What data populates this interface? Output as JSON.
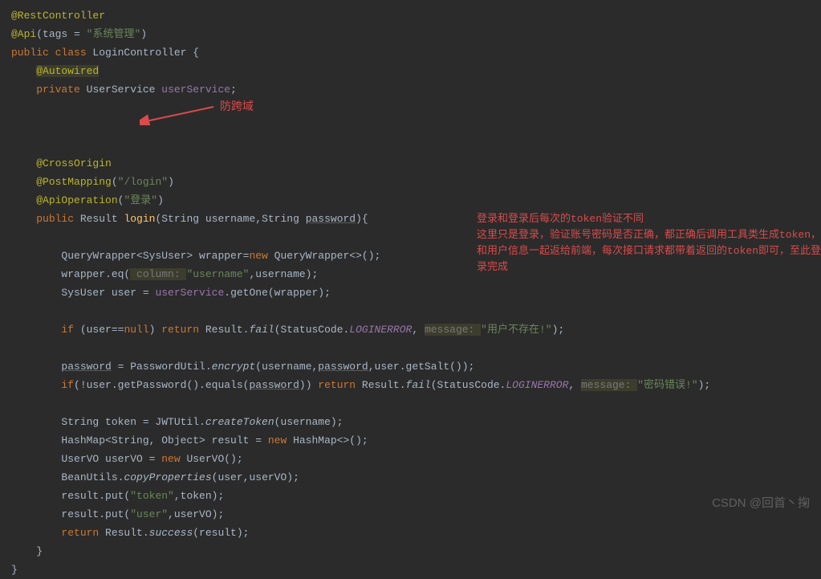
{
  "code": {
    "l1a": "@RestController",
    "l2a": "@Api",
    "l2b": "(tags = ",
    "l2c": "\"系统管理\"",
    "l2d": ")",
    "l3a": "public class ",
    "l3b": "LoginController {",
    "l4a": "    ",
    "l4b": "@Autowired",
    "l5a": "    ",
    "l5b": "private ",
    "l5c": "UserService ",
    "l5d": "userService",
    "l5e": ";",
    "l6a": "    ",
    "l6b": "@CrossOrigin",
    "l7a": "    ",
    "l7b": "@PostMapping",
    "l7c": "(",
    "l7d": "\"/login\"",
    "l7e": ")",
    "l8a": "    ",
    "l8b": "@ApiOperation",
    "l8c": "(",
    "l8d": "\"登录\"",
    "l8e": ")",
    "l9a": "    ",
    "l9b": "public ",
    "l9c": "Result ",
    "l9d": "login",
    "l9e": "(String username,String ",
    "l9f": "password",
    "l9g": "){",
    "l10a": "        QueryWrapper<SysUser> wrapper=",
    "l10b": "new ",
    "l10c": "QueryWrapper<>();",
    "l11a": "        wrapper.eq(",
    "l11b": " column: ",
    "l11c": "\"username\"",
    "l11d": ",username);",
    "l12a": "        SysUser user = ",
    "l12b": "userService",
    "l12c": ".getOne(wrapper);",
    "l13a": "        ",
    "l13b": "if ",
    "l13c": "(user==",
    "l13d": "null",
    "l13e": ") ",
    "l13f": "return ",
    "l13g": "Result.",
    "l13h": "fail",
    "l13i": "(StatusCode.",
    "l13j": "LOGINERROR",
    "l13k": ", ",
    "l13l": "message: ",
    "l13m": "\"用户不存在!\"",
    "l13n": ");",
    "l14a": "        ",
    "l14b": "password",
    "l14c": " = PasswordUtil.",
    "l14d": "encrypt",
    "l14e": "(username,",
    "l14f": "password",
    "l14g": ",user.getSalt());",
    "l15a": "        ",
    "l15b": "if",
    "l15c": "(!user.getPassword().equals(",
    "l15d": "password",
    "l15e": ")) ",
    "l15f": "return ",
    "l15g": "Result.",
    "l15h": "fail",
    "l15i": "(StatusCode.",
    "l15j": "LOGINERROR",
    "l15k": ", ",
    "l15l": "message: ",
    "l15m": "\"密码错误!\"",
    "l15n": ");",
    "l16a": "        String token = JWTUtil.",
    "l16b": "createToken",
    "l16c": "(username);",
    "l17a": "        HashMap<String, Object> result = ",
    "l17b": "new ",
    "l17c": "HashMap<>();",
    "l18a": "        UserVO userVO = ",
    "l18b": "new ",
    "l18c": "UserVO();",
    "l19a": "        BeanUtils.",
    "l19b": "copyProperties",
    "l19c": "(user,userVO);",
    "l20a": "        result.put(",
    "l20b": "\"token\"",
    "l20c": ",token);",
    "l21a": "        result.put(",
    "l21b": "\"user\"",
    "l21c": ",userVO);",
    "l22a": "        ",
    "l22b": "return ",
    "l22c": "Result.",
    "l22d": "success",
    "l22e": "(result);",
    "l23": "    }",
    "l24": "}"
  },
  "annotations": {
    "red_label": "防跨域",
    "red_note": "登录和登录后每次的token验证不同\n这里只是登录，验证账号密码是否正确，都正确后调用工具类生成token，和用户信息一起返给前端，每次接口请求都带着返回的token即可，至此登录完成"
  },
  "watermark": "CSDN @回首丶掬"
}
